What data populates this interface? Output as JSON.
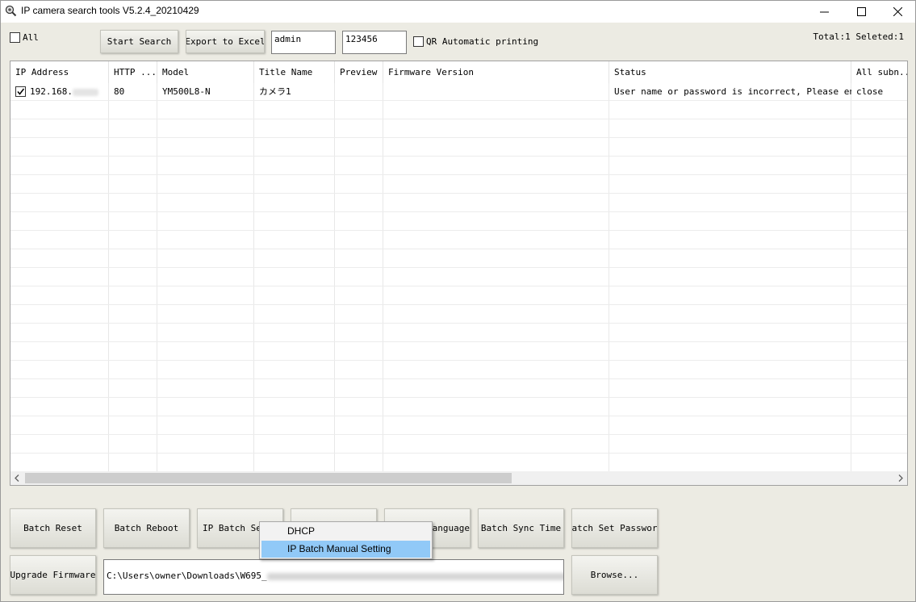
{
  "window": {
    "title": "IP camera search tools V5.2.4_20210429"
  },
  "toolbar": {
    "all_label": "All",
    "start_search": "Start Search",
    "export_excel": "Export to Excel",
    "username": "admin",
    "password": "123456",
    "qr_label": "QR Automatic printing",
    "total_selected": "Total:1 Seleted:1"
  },
  "table": {
    "columns": [
      "IP Address",
      "HTTP ...",
      "Model",
      "Title Name",
      "Preview",
      "Firmware Version",
      "Status",
      "All subn..."
    ],
    "rows": [
      {
        "ip": "192.168.",
        "http": "80",
        "model": "YM500L8-N",
        "title": "カメラ1",
        "preview": "",
        "firmware": "",
        "status": "User name or password is incorrect, Please en...",
        "subnet": "close"
      }
    ]
  },
  "bottom": {
    "batch_reset": "Batch Reset",
    "batch_reboot": "Batch Reboot",
    "ip_batch_set": "IP Batch Set",
    "language": "Language",
    "batch_sync_time": "Batch Sync Time",
    "batch_set_password": "Batch Set Password",
    "upgrade_firmware": "Upgrade Firmware",
    "firmware_path": "C:\\Users\\owner\\Downloads\\W695_",
    "browse": "Browse..."
  },
  "context_menu": {
    "items": [
      "DHCP",
      "IP Batch Manual Setting"
    ],
    "selected_index": 1
  }
}
